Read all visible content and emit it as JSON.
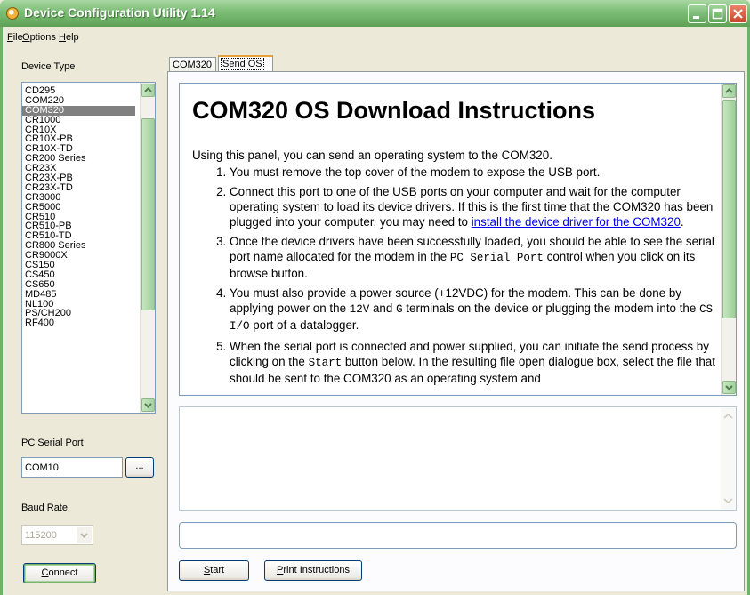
{
  "window": {
    "title": "Device Configuration Utility 1.14"
  },
  "menu": [
    {
      "label": "File",
      "mnemonic": "F",
      "rest": "ile"
    },
    {
      "label": "Options",
      "mnemonic": "O",
      "rest": "ptions"
    },
    {
      "label": "Help",
      "mnemonic": "H",
      "rest": "elp"
    }
  ],
  "sidebar": {
    "device_type_label": "Device Type",
    "devices": [
      "CD295",
      "COM220",
      "COM320",
      "CR1000",
      "CR10X",
      "CR10X-PB",
      "CR10X-TD",
      "CR200 Series",
      "CR23X",
      "CR23X-PB",
      "CR23X-TD",
      "CR3000",
      "CR5000",
      "CR510",
      "CR510-PB",
      "CR510-TD",
      "CR800 Series",
      "CR9000X",
      "CS150",
      "CS450",
      "CS650",
      "MD485",
      "NL100",
      "PS/CH200",
      "RF400"
    ],
    "selected_device": "COM320",
    "serial_port_label": "PC Serial Port",
    "serial_port_value": "COM10",
    "browse_label": "...",
    "baud_rate_label": "Baud Rate",
    "baud_rate_value": "115200",
    "connect_label": "Connect",
    "connect_mnemonic": "C",
    "connect_rest": "onnect"
  },
  "tabs": [
    {
      "label": "COM320",
      "active": false
    },
    {
      "label": "Send OS",
      "active": true
    }
  ],
  "instructions": {
    "heading": "COM320 OS Download Instructions",
    "intro": "Using this panel, you can send an operating system to the COM320.",
    "step1": "You must remove the top cover of the modem to expose the USB port.",
    "step2_text": "Connect this port to one of the USB ports on your computer and wait for the computer operating system to load its device drivers. If this is the first time that the COM320 has been plugged into your computer, you may need to ",
    "step2_link": "install the device driver for the COM320",
    "step2_end": ".",
    "step3_a": "Once the device drivers have been successfully loaded, you should be able to see the serial port name allocated for the modem in the ",
    "step3_code": "PC Serial Port",
    "step3_b": " control when you click on its browse button.",
    "step4_a": "You must also provide a power source (+12VDC) for the modem. This can be done by applying power on the ",
    "step4_code1": "12V",
    "step4_b": " and ",
    "step4_code2": "G",
    "step4_c": " terminals on the device or plugging the modem into the ",
    "step4_code3": "CS I/O",
    "step4_d": " port of a datalogger.",
    "step5_a": "When the serial port is connected and power supplied, you can initiate the send process by clicking on the ",
    "step5_code": "Start",
    "step5_b": " button below. In the resulting file open dialogue box, select the file that should be sent to the COM320 as an operating system and"
  },
  "buttons": {
    "start_label": "Start",
    "start_mnemonic": "S",
    "start_rest": "tart",
    "print_label": "Print Instructions",
    "print_mnemonic": "P",
    "print_rest": "rint Instructions"
  },
  "colors": {
    "title_bar": "#6FB267",
    "selection": "#808080",
    "link": "#0000EE"
  }
}
